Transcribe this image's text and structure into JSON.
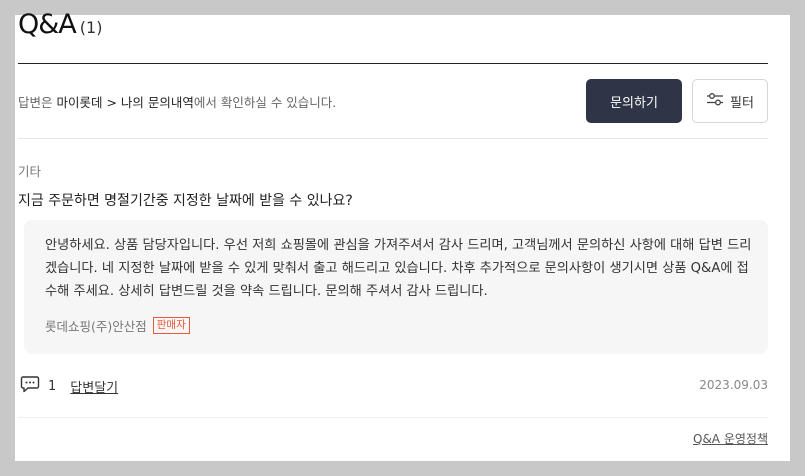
{
  "header": {
    "title": "Q&A",
    "count": "(1)"
  },
  "notice": {
    "prefix": "답변은 ",
    "path": "마이롯데 > 나의 문의내역",
    "suffix": "에서 확인하실 수 있습니다."
  },
  "actions": {
    "ask_label": "문의하기",
    "filter_label": "필터",
    "filter_icon": "sliders-icon"
  },
  "qa_item": {
    "category": "기타",
    "question": "지금 주문하면 명절기간중 지정한 날짜에 받을 수 있나요?",
    "answer": "안녕하세요. 상품 담당자입니다. 우선 저희 쇼핑몰에 관심을 가져주셔서 감사 드리며, 고객님께서 문의하신 사항에 대해 답변 드리겠습니다. 네 지정한 날짜에 받을 수 있게 맞춰서 출고 해드리고 있습니다. 차후 추가적으로 문의사항이 생기시면 상품 Q&A에 접수해 주세요. 상세히 답변드릴 것을 약속 드립니다. 문의해 주셔서 감사 드립니다.",
    "seller_name": "롯데쇼핑(주)안산점",
    "seller_badge": "판매자",
    "comment_icon": "comment-icon",
    "comment_count": "1",
    "reply_label": "답변달기",
    "date": "2023.09.03"
  },
  "footer": {
    "policy_link": "Q&A 운영정책"
  },
  "colors": {
    "primary_button": "#2f3446",
    "badge": "#e85a3a",
    "answer_bg": "#f6f6f6"
  }
}
